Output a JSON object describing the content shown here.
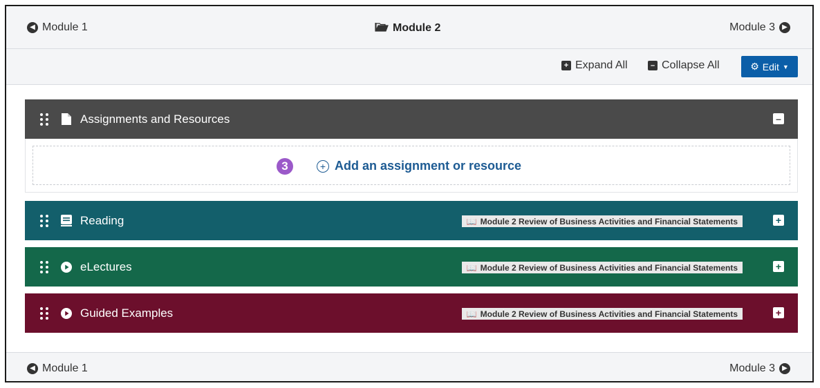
{
  "nav": {
    "prev_label": "Module 1",
    "current_label": "Module 2",
    "next_label": "Module 3"
  },
  "toolbar": {
    "expand_all_label": "Expand All",
    "collapse_all_label": "Collapse All",
    "edit_label": "Edit"
  },
  "panels": [
    {
      "title": "Assignments and Resources",
      "icon": "file-icon",
      "color": "#4a4a4a",
      "expanded": true
    },
    {
      "title": "Reading",
      "icon": "book-icon",
      "color": "#135f6b",
      "badge": "Module 2 Review of Business Activities and Financial Statements",
      "expanded": false
    },
    {
      "title": "eLectures",
      "icon": "play-circle-icon",
      "color": "#14684a",
      "badge": "Module 2 Review of Business Activities and Financial Statements",
      "expanded": false
    },
    {
      "title": "Guided Examples",
      "icon": "play-circle-icon",
      "color": "#6c0f2c",
      "badge": "Module 2 Review of Business Activities and Financial Statements",
      "expanded": false
    }
  ],
  "add_resource": {
    "step_number": "3",
    "label": "Add an assignment or resource"
  },
  "footer_nav": {
    "prev_label": "Module 1",
    "next_label": "Module 3"
  }
}
